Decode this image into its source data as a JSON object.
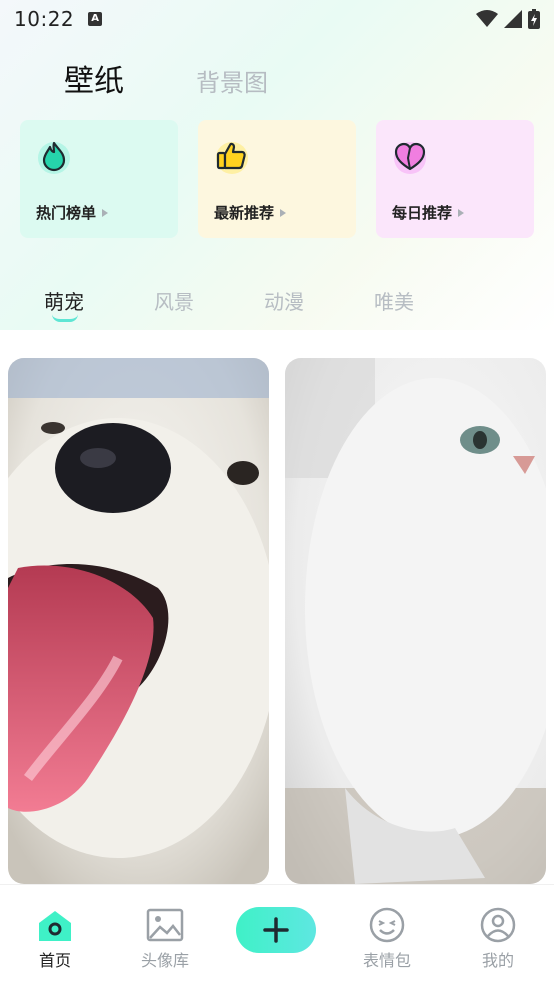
{
  "status_bar": {
    "time": "10:22",
    "notif_letter": "A"
  },
  "top_tabs": [
    {
      "label": "壁纸",
      "active": true
    },
    {
      "label": "背景图",
      "active": false
    }
  ],
  "feature_cards": [
    {
      "label": "热门榜单",
      "icon": "flame-icon",
      "color": "#dcfaf1"
    },
    {
      "label": "最新推荐",
      "icon": "thumbs-up-icon",
      "color": "#fdf7df"
    },
    {
      "label": "每日推荐",
      "icon": "heart-icon",
      "color": "#fbe6fb"
    }
  ],
  "category_tabs": [
    {
      "label": "萌宠",
      "active": true
    },
    {
      "label": "风景",
      "active": false
    },
    {
      "label": "动漫",
      "active": false
    },
    {
      "label": "唯美",
      "active": false
    }
  ],
  "photos": [
    {
      "subject": "samoyed-puppy"
    },
    {
      "subject": "white-persian-cat"
    }
  ],
  "bottom_nav": [
    {
      "label": "首页",
      "icon": "home-icon",
      "active": true
    },
    {
      "label": "头像库",
      "icon": "image-icon",
      "active": false
    },
    {
      "label": "",
      "icon": "plus-icon",
      "active": false
    },
    {
      "label": "表情包",
      "icon": "smiley-icon",
      "active": false
    },
    {
      "label": "我的",
      "icon": "user-icon",
      "active": false
    }
  ],
  "accent_color": "#3ff1c7"
}
